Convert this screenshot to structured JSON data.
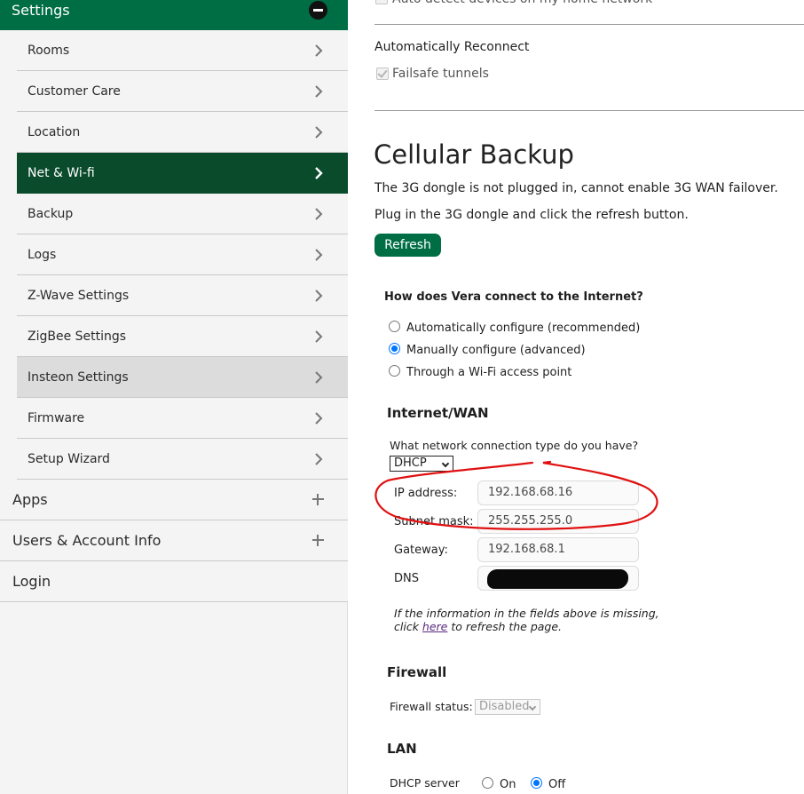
{
  "sidebar": {
    "section_title": "Settings",
    "items": [
      {
        "label": "Rooms"
      },
      {
        "label": "Customer Care"
      },
      {
        "label": "Location"
      },
      {
        "label": "Net & Wi-fi"
      },
      {
        "label": "Backup"
      },
      {
        "label": "Logs"
      },
      {
        "label": "Z-Wave Settings"
      },
      {
        "label": "ZigBee Settings"
      },
      {
        "label": "Insteon Settings"
      },
      {
        "label": "Firmware"
      },
      {
        "label": "Setup Wizard"
      }
    ],
    "top_items": [
      {
        "label": "Apps"
      },
      {
        "label": "Users & Account Info"
      },
      {
        "label": "Login"
      }
    ]
  },
  "main": {
    "partial_top_text": "Auto detect devices on my home network",
    "reconnect": {
      "heading": "Automatically Reconnect",
      "failsafe_label": "Failsafe tunnels"
    },
    "cellular": {
      "title": "Cellular Backup",
      "line1": "The 3G dongle is not plugged in, cannot enable 3G WAN failover.",
      "line2": "Plug in the 3G dongle and click the refresh button.",
      "refresh_label": "Refresh"
    },
    "connect": {
      "question": "How does Vera connect to the Internet?",
      "options": [
        {
          "label": "Automatically configure (recommended)",
          "selected": false
        },
        {
          "label": "Manually configure (advanced)",
          "selected": true
        },
        {
          "label": "Through a Wi-Fi access point",
          "selected": false
        }
      ]
    },
    "wan": {
      "heading": "Internet/WAN",
      "type_question": "What network connection type do you have?",
      "type_value": "DHCP",
      "ip_label": "IP address:",
      "ip_value": "192.168.68.16",
      "subnet_label": "Subnet mask:",
      "subnet_value": "255.255.255.0",
      "gateway_label": "Gateway:",
      "gateway_value": "192.168.68.1",
      "dns_label": "DNS",
      "note_part1": "If the information in the fields above is missing,",
      "note_part2": "click",
      "note_link": "here",
      "note_part3": "to refresh the page."
    },
    "firewall": {
      "heading": "Firewall",
      "status_label": "Firewall status:",
      "status_value": "Disabled"
    },
    "lan": {
      "heading": "LAN",
      "dhcp_label": "DHCP server",
      "on_label": "On",
      "off_label": "Off",
      "dhcp_on": false
    }
  },
  "colors": {
    "brand_green": "#006e44",
    "active_item": "#0a4b2c",
    "annotation_red": "#e01010",
    "radio_blue": "#0075ff"
  }
}
